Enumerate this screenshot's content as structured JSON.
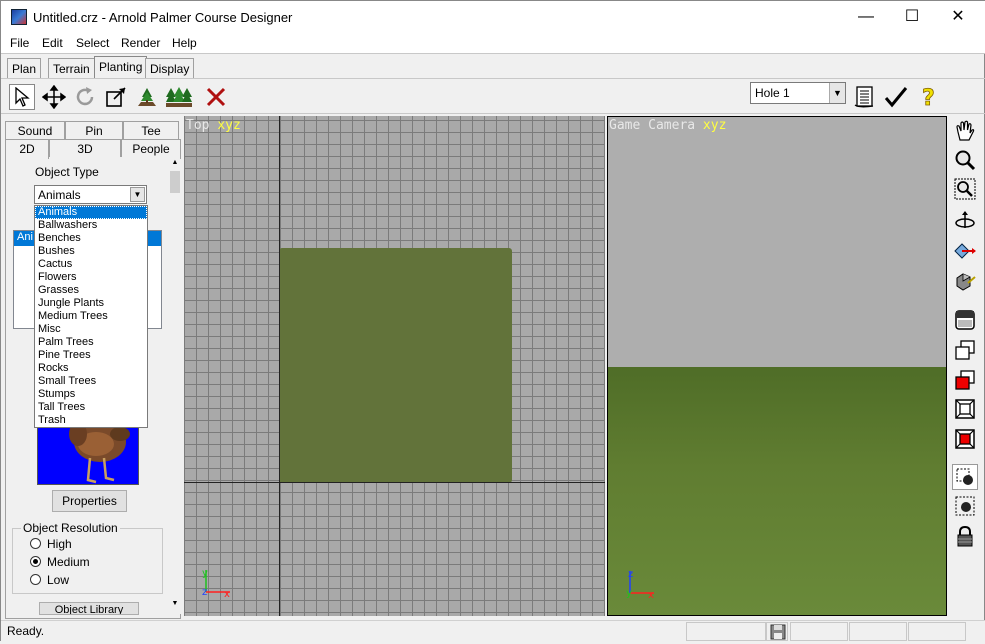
{
  "window": {
    "title": "Untitled.crz - Arnold Palmer Course Designer",
    "minimize": "—",
    "maximize": "☐",
    "close": "✕"
  },
  "menu": [
    "File",
    "Edit",
    "Select",
    "Render",
    "Help"
  ],
  "mode_tabs": [
    "Plan",
    "Terrain",
    "Planting",
    "Display"
  ],
  "active_mode_tab": "Planting",
  "toolbar": {
    "hole_select_value": "Hole 1",
    "tools": [
      "select-arrow-icon",
      "move-icon",
      "rotate-icon",
      "scale-icon",
      "plant-single-icon",
      "plant-group-icon",
      "delete-icon"
    ],
    "right_tools": [
      "scorecard-icon",
      "checkmark-icon",
      "help-question-icon"
    ]
  },
  "panel_tabs_row1": [
    "Sound",
    "Pin",
    "Tee"
  ],
  "panel_tabs_row2": [
    "2D",
    "3D",
    "People"
  ],
  "active_panel_tab": "2D",
  "object_type": {
    "label": "Object Type",
    "value": "Animals",
    "options": [
      "Animals",
      "Ballwashers",
      "Benches",
      "Bushes",
      "Cactus",
      "Flowers",
      "Grasses",
      "Jungle Plants",
      "Medium Trees",
      "Misc",
      "Palm Trees",
      "Pine Trees",
      "Rocks",
      "Small Trees",
      "Stumps",
      "Tall Trees",
      "Trash"
    ],
    "selected_option": "Animals"
  },
  "object_list_visible_fragment": "Ani",
  "properties_button": "Properties",
  "object_resolution": {
    "title": "Object Resolution",
    "options": [
      "High",
      "Medium",
      "Low"
    ],
    "selected": "Medium"
  },
  "object_library_button": "Object Library",
  "viewports": {
    "top": {
      "label_prefix": "Top ",
      "axes": "xyz"
    },
    "game": {
      "label_prefix": "Game Camera ",
      "axes": "xyz"
    }
  },
  "axis_labels": {
    "x": "x",
    "y": "y",
    "z": "z"
  },
  "status": {
    "text": "Ready."
  },
  "colors": {
    "accent": "#0078d7",
    "course_green": "#62733a",
    "grid_bg": "#a9a9a9",
    "sky": "#aeaeae",
    "grass": "#607d31",
    "preview_bg": "#0000ff",
    "axis_x": "#ff2020",
    "axis_y": "#20c020",
    "axis_z": "#2040ff",
    "xyz_label": "#ffff40"
  }
}
